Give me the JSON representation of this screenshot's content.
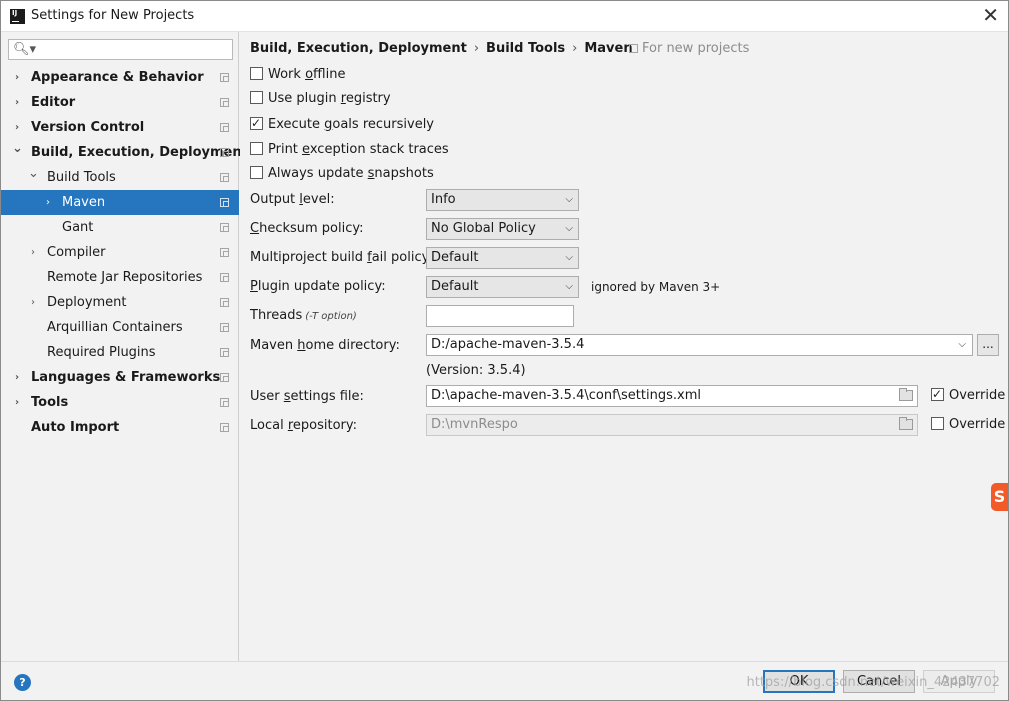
{
  "window": {
    "title": "Settings for New Projects",
    "close_glyph": "✕"
  },
  "sidebar": {
    "search_placeholder": "",
    "items": [
      {
        "label": "Appearance & Behavior",
        "level": 0,
        "arrow": "›",
        "bold": true
      },
      {
        "label": "Editor",
        "level": 0,
        "arrow": "›",
        "bold": true
      },
      {
        "label": "Version Control",
        "level": 0,
        "arrow": "›",
        "bold": true
      },
      {
        "label": "Build, Execution, Deployment",
        "level": 0,
        "arrow": "⌄",
        "bold": true
      },
      {
        "label": "Build Tools",
        "level": 1,
        "arrow": "⌄",
        "bold": false
      },
      {
        "label": "Maven",
        "level": 2,
        "arrow": "›",
        "bold": false,
        "selected": true
      },
      {
        "label": "Gant",
        "level": 2,
        "arrow": "",
        "bold": false
      },
      {
        "label": "Compiler",
        "level": 1,
        "arrow": "›",
        "bold": false
      },
      {
        "label": "Remote Jar Repositories",
        "level": 1,
        "arrow": "",
        "bold": false
      },
      {
        "label": "Deployment",
        "level": 1,
        "arrow": "›",
        "bold": false
      },
      {
        "label": "Arquillian Containers",
        "level": 1,
        "arrow": "",
        "bold": false
      },
      {
        "label": "Required Plugins",
        "level": 1,
        "arrow": "",
        "bold": false
      },
      {
        "label": "Languages & Frameworks",
        "level": 0,
        "arrow": "›",
        "bold": true
      },
      {
        "label": "Tools",
        "level": 0,
        "arrow": "›",
        "bold": true
      },
      {
        "label": "Auto Import",
        "level": 0,
        "arrow": "",
        "bold": true
      }
    ]
  },
  "breadcrumb": {
    "part1": "Build, Execution, Deployment",
    "part2": "Build Tools",
    "part3": "Maven",
    "separator": "›",
    "for_new_projects": "For new projects"
  },
  "checkboxes": {
    "work_offline": {
      "pre": "Work ",
      "mnemonic": "o",
      "post": "ffline",
      "checked": false
    },
    "use_plugin_registry": {
      "pre": "Use plugin ",
      "mnemonic": "r",
      "post": "egistry",
      "checked": false
    },
    "execute_goals": {
      "pre": "Execute ",
      "mnemonic": "g",
      "post": "oals recursively",
      "checked": true
    },
    "print_exception": {
      "pre": "Print ",
      "mnemonic": "e",
      "post": "xception stack traces",
      "checked": false
    },
    "always_update": {
      "pre": "Always update ",
      "mnemonic": "s",
      "post": "napshots",
      "checked": false
    }
  },
  "form": {
    "output_level": {
      "pre": "Output ",
      "mnemonic": "l",
      "post": "evel:",
      "value": "Info"
    },
    "checksum_policy": {
      "pre": "",
      "mnemonic": "C",
      "post": "hecksum policy:",
      "value": "No Global Policy"
    },
    "multiproject_policy": {
      "pre": "Multiproject build ",
      "mnemonic": "f",
      "post": "ail policy:",
      "value": "Default"
    },
    "plugin_update_policy": {
      "pre": "",
      "mnemonic": "P",
      "post": "lugin update policy:",
      "value": "Default",
      "note": "ignored by Maven 3+"
    },
    "threads": {
      "label": "Threads",
      "hint": "(-T option)",
      "value": ""
    },
    "maven_home": {
      "pre": "Maven ",
      "mnemonic": "h",
      "post": "ome directory:",
      "value": "D:/apache-maven-3.5.4",
      "browse": "...",
      "version": "(Version: 3.5.4)"
    },
    "user_settings": {
      "pre": "User ",
      "mnemonic": "s",
      "post": "ettings file:",
      "value": "D:\\apache-maven-3.5.4\\conf\\settings.xml",
      "override_label": "Override",
      "override_checked": true
    },
    "local_repository": {
      "pre": "Local ",
      "mnemonic": "r",
      "post": "epository:",
      "value": "D:\\mvnRespo",
      "override_label": "Override",
      "override_checked": false
    }
  },
  "footer": {
    "help": "?",
    "ok": "OK",
    "cancel": "Cancel",
    "apply": "Apply",
    "watermark": "https://blog.csdn.net/weixin_42437702"
  },
  "side_logo": "S"
}
